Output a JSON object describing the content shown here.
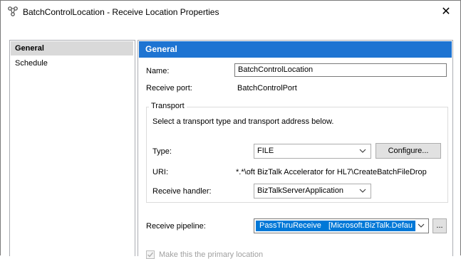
{
  "window": {
    "title": "BatchControlLocation - Receive Location Properties",
    "close_glyph": "✕"
  },
  "sidebar": {
    "items": [
      {
        "label": "General",
        "selected": true
      },
      {
        "label": "Schedule",
        "selected": false
      }
    ]
  },
  "panel": {
    "header": "General",
    "name_label": "Name:",
    "name_value": "BatchControlLocation",
    "port_label": "Receive port:",
    "port_value": "BatchControlPort",
    "transport": {
      "group_title": "Transport",
      "description": "Select a transport type and transport address below.",
      "type_label": "Type:",
      "type_value": "FILE",
      "configure_label": "Configure...",
      "uri_label": "URI:",
      "uri_value": "oft BizTalk Accelerator for HL7\\CreateBatchFileDrop\\*.*",
      "handler_label": "Receive handler:",
      "handler_value": "BizTalkServerApplication"
    },
    "pipeline_label": "Receive pipeline:",
    "pipeline_name": "PassThruReceive",
    "pipeline_assembly": "[Microsoft.BizTalk.Defau",
    "pipeline_browse_label": "...",
    "primary_checkbox_label": "Make this the primary location",
    "primary_checked": true
  },
  "colors": {
    "header_blue": "#1e74d2",
    "selection_blue": "#0078d7",
    "nav_selected": "#d9d9d9"
  },
  "icons": [
    "receive-location-icon",
    "close-icon",
    "chevron-down-icon",
    "checkmark-icon"
  ]
}
